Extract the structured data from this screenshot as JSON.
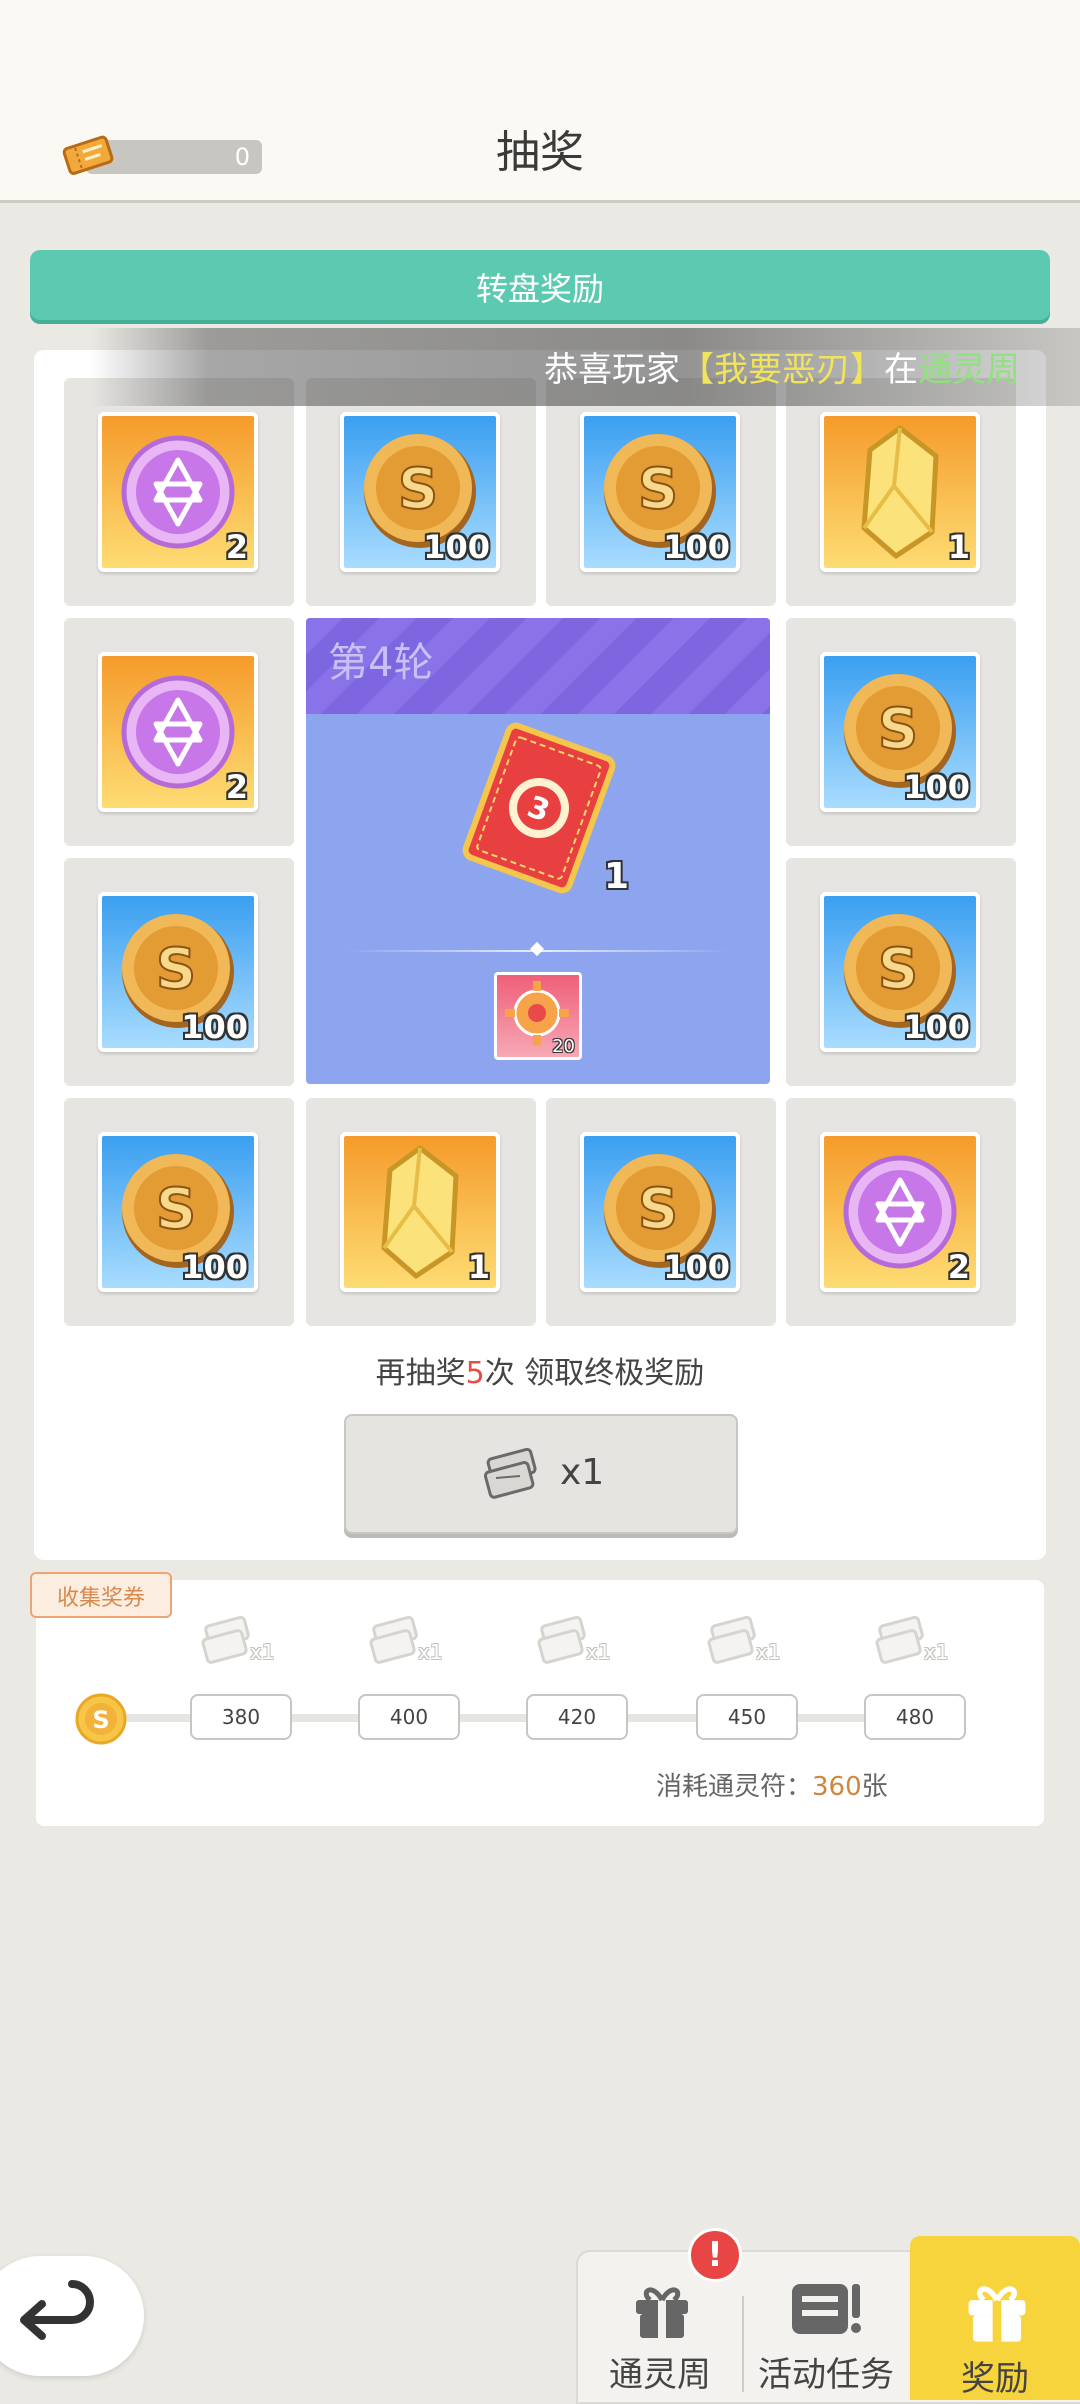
{
  "header": {
    "title": "抽奖",
    "ticket_count": "0"
  },
  "banner": {
    "label": "转盘奖励"
  },
  "marquee": {
    "prefix": "恭喜玩家",
    "player": "【我要恶刃】",
    "mid": "在",
    "event": "通灵周"
  },
  "grid": {
    "cells": [
      {
        "item": "purple-star-orb-icon",
        "bg": "orange",
        "qty": "2"
      },
      {
        "item": "gold-coin-icon",
        "bg": "blue",
        "qty": "100"
      },
      {
        "item": "gold-coin-icon",
        "bg": "blue",
        "qty": "100"
      },
      {
        "item": "yellow-crystal-icon",
        "bg": "orange",
        "qty": "1"
      },
      {
        "item": "purple-star-orb-icon",
        "bg": "orange",
        "qty": "2"
      },
      {
        "item": "gold-coin-icon",
        "bg": "blue",
        "qty": "100"
      },
      {
        "item": "gold-coin-icon",
        "bg": "blue",
        "qty": "100"
      },
      {
        "item": "gold-coin-icon",
        "bg": "blue",
        "qty": "100"
      },
      {
        "item": "gold-coin-icon",
        "bg": "blue",
        "qty": "100"
      },
      {
        "item": "yellow-crystal-icon",
        "bg": "orange",
        "qty": "1"
      },
      {
        "item": "gold-coin-icon",
        "bg": "blue",
        "qty": "100"
      },
      {
        "item": "purple-star-orb-icon",
        "bg": "orange",
        "qty": "2"
      }
    ]
  },
  "center": {
    "round_label": "第4轮",
    "card_qty": "1",
    "token_qty": "20"
  },
  "progress": {
    "prefix": "再抽奖",
    "count": "5",
    "suffix": "次 领取终极奖励"
  },
  "draw_button": {
    "label": "x1"
  },
  "collect": {
    "tag": "收集奖券",
    "milestones": [
      {
        "value": "380",
        "reward": "x1"
      },
      {
        "value": "400",
        "reward": "x1"
      },
      {
        "value": "420",
        "reward": "x1"
      },
      {
        "value": "450",
        "reward": "x1"
      },
      {
        "value": "480",
        "reward": "x1"
      }
    ],
    "consume_prefix": "消耗通灵符：",
    "consume_count": "360",
    "consume_suffix": "张"
  },
  "tabs": [
    {
      "label": "通灵周",
      "icon": "gift-icon",
      "alert": "!"
    },
    {
      "label": "活动任务",
      "icon": "task-board-icon"
    },
    {
      "label": "奖励",
      "icon": "gift-icon",
      "active": true
    }
  ],
  "colors": {
    "accent": "#5ccab0",
    "active_tab": "#f7d33c",
    "highlight_number": "#e84d43"
  }
}
